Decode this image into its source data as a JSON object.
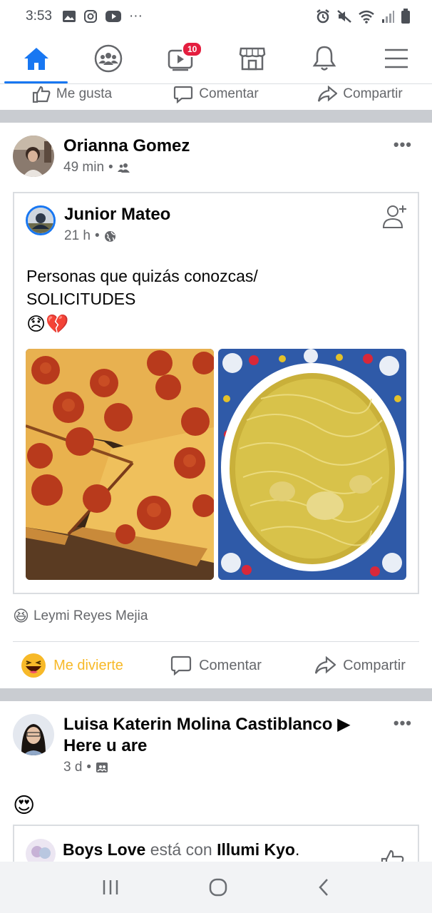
{
  "status": {
    "time": "3:53",
    "left_icons": [
      "gallery-icon",
      "instagram-icon",
      "youtube-icon",
      "more-dots"
    ],
    "right_icons": [
      "alarm-icon",
      "mute-icon",
      "wifi-icon",
      "signal-icon",
      "battery-icon"
    ],
    "more_text": "···"
  },
  "nav": {
    "tabs": [
      {
        "name": "home",
        "icon": "home-icon",
        "active": true
      },
      {
        "name": "groups",
        "icon": "groups-icon",
        "active": false
      },
      {
        "name": "watch",
        "icon": "watch-icon",
        "badge": "10",
        "active": false
      },
      {
        "name": "marketplace",
        "icon": "marketplace-icon",
        "active": false
      },
      {
        "name": "notifications",
        "icon": "bell-icon",
        "active": false
      },
      {
        "name": "menu",
        "icon": "hamburger-icon",
        "active": false
      }
    ],
    "accent": "#1877f2",
    "badge_color": "#e41e3f"
  },
  "prev_post": {
    "like": "Me gusta",
    "comment": "Comentar",
    "share": "Compartir"
  },
  "post1": {
    "author": "Orianna Gomez",
    "time": "49 min",
    "privacy_icon": "friends-icon",
    "more": "•••",
    "shared": {
      "author": "Junior Mateo",
      "time": "21 h",
      "privacy_icon": "globe-icon",
      "text": "Personas que quizás conozcas/\nSOLICITUDES",
      "emojis": "😞💔",
      "images": [
        "pepperoni-pizza-photo",
        "noodle-soup-photo"
      ]
    },
    "reaction_emoji": "😆",
    "reaction_by": "Leymi Reyes Mejia",
    "actions": {
      "react": "Me divierte",
      "comment": "Comentar",
      "share": "Compartir"
    },
    "react_color": "#f7b928"
  },
  "post2": {
    "author_line1": "Luisa Katerin Molina Castiblanco ▶",
    "author_line2": "Here u are",
    "time": "3 d",
    "privacy_icon": "group-page-icon",
    "more": "•••",
    "body_emoji": "😍",
    "inner": {
      "author": "Boys Love",
      "connector": "está con",
      "with": "Illumi Kyo",
      "end": "."
    }
  },
  "android_nav": [
    "recents-icon",
    "home-circle-icon",
    "back-icon"
  ]
}
